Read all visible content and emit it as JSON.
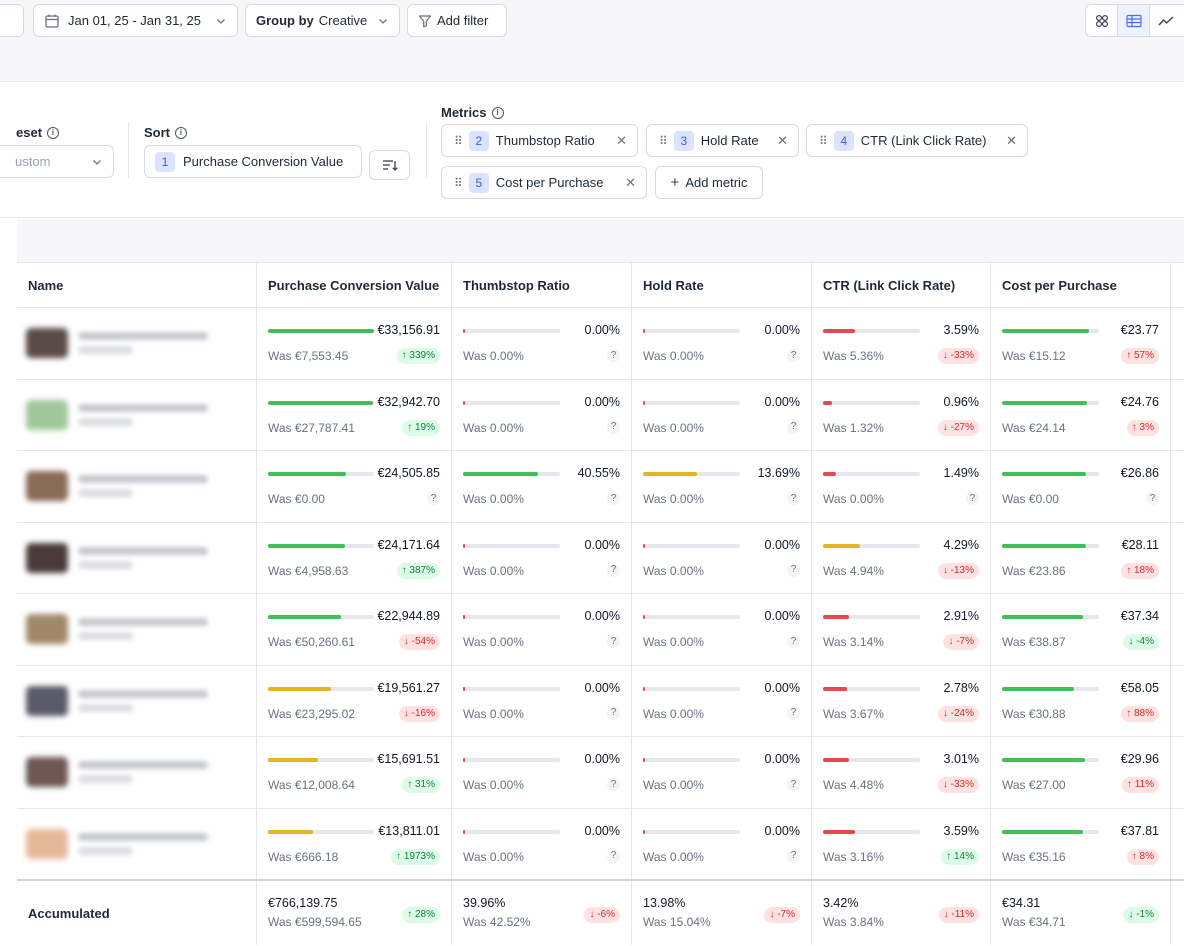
{
  "toolbar": {
    "date_range": "Jan 01, 25 - Jan 31, 25",
    "group_by_label": "Group by",
    "group_by_value": "Creative",
    "add_filter": "Add filter",
    "calendar_icon": "calendar-icon",
    "filter_icon": "filter-icon",
    "views": [
      {
        "icon": "grid-view-icon",
        "active": false
      },
      {
        "icon": "table-view-icon",
        "active": true
      },
      {
        "icon": "trend-view-icon",
        "active": false
      }
    ]
  },
  "config": {
    "preset_label": "eset",
    "preset_value": "ustom",
    "sort_label": "Sort",
    "sort_index": "1",
    "sort_metric": "Purchase Conversion Value",
    "metrics_label": "Metrics",
    "metrics": [
      {
        "index": "2",
        "label": "Thumbstop Ratio"
      },
      {
        "index": "3",
        "label": "Hold Rate"
      },
      {
        "index": "4",
        "label": "CTR (Link Click Rate)"
      },
      {
        "index": "5",
        "label": "Cost per Purchase"
      }
    ],
    "add_metric": "Add metric"
  },
  "table": {
    "columns": [
      "Name",
      "Purchase Conversion Value",
      "Thumbstop Ratio",
      "Hold Rate",
      "CTR (Link Click Rate)",
      "Cost per Purchase"
    ],
    "rows": [
      {
        "thumb_color": "#5a4a48",
        "cells": [
          {
            "value": "€33,156.91",
            "was": "Was €7,553.45",
            "change": "↑ 339%",
            "dir": "up",
            "bar": 1.0,
            "color": "#3fbf57"
          },
          {
            "value": "0.00%",
            "was": "Was 0.00%",
            "change": "?",
            "dir": "q",
            "bar": 0.0,
            "color": "#e5484d"
          },
          {
            "value": "0.00%",
            "was": "Was 0.00%",
            "change": "?",
            "dir": "q",
            "bar": 0.0,
            "color": "#e5484d"
          },
          {
            "value": "3.59%",
            "was": "Was 5.36%",
            "change": "↓ -33%",
            "dir": "down",
            "bar": 0.33,
            "color": "#e5484d"
          },
          {
            "value": "€23.77",
            "was": "Was €15.12",
            "change": "↑ 57%",
            "dir": "down",
            "bar": 0.9,
            "color": "#3fbf57"
          }
        ]
      },
      {
        "thumb_color": "#9fc79a",
        "cells": [
          {
            "value": "€32,942.70",
            "was": "Was €27,787.41",
            "change": "↑ 19%",
            "dir": "up",
            "bar": 0.99,
            "color": "#3fbf57"
          },
          {
            "value": "0.00%",
            "was": "Was 0.00%",
            "change": "?",
            "dir": "q",
            "bar": 0.0,
            "color": "#e5484d"
          },
          {
            "value": "0.00%",
            "was": "Was 0.00%",
            "change": "?",
            "dir": "q",
            "bar": 0.0,
            "color": "#e5484d"
          },
          {
            "value": "0.96%",
            "was": "Was 1.32%",
            "change": "↓ -27%",
            "dir": "down",
            "bar": 0.09,
            "color": "#e5484d"
          },
          {
            "value": "€24.76",
            "was": "Was €24.14",
            "change": "↑ 3%",
            "dir": "down",
            "bar": 0.88,
            "color": "#3fbf57"
          }
        ]
      },
      {
        "thumb_color": "#8a6a58",
        "cells": [
          {
            "value": "€24,505.85",
            "was": "Was €0.00",
            "change": "?",
            "dir": "q",
            "bar": 0.74,
            "color": "#3fbf57"
          },
          {
            "value": "40.55%",
            "was": "Was 0.00%",
            "change": "?",
            "dir": "q",
            "bar": 0.77,
            "color": "#3fbf57"
          },
          {
            "value": "13.69%",
            "was": "Was 0.00%",
            "change": "?",
            "dir": "q",
            "bar": 0.56,
            "color": "#e6b422"
          },
          {
            "value": "1.49%",
            "was": "Was 0.00%",
            "change": "?",
            "dir": "q",
            "bar": 0.13,
            "color": "#e5484d"
          },
          {
            "value": "€26.86",
            "was": "Was €0.00",
            "change": "?",
            "dir": "q",
            "bar": 0.87,
            "color": "#3fbf57"
          }
        ]
      },
      {
        "thumb_color": "#4a3a3a",
        "cells": [
          {
            "value": "€24,171.64",
            "was": "Was €4,958.63",
            "change": "↑ 387%",
            "dir": "up",
            "bar": 0.73,
            "color": "#3fbf57"
          },
          {
            "value": "0.00%",
            "was": "Was 0.00%",
            "change": "?",
            "dir": "q",
            "bar": 0.0,
            "color": "#e5484d"
          },
          {
            "value": "0.00%",
            "was": "Was 0.00%",
            "change": "?",
            "dir": "q",
            "bar": 0.0,
            "color": "#e5484d"
          },
          {
            "value": "4.29%",
            "was": "Was 4.94%",
            "change": "↓ -13%",
            "dir": "down",
            "bar": 0.38,
            "color": "#e6b422"
          },
          {
            "value": "€28.11",
            "was": "Was €23.86",
            "change": "↑ 18%",
            "dir": "down",
            "bar": 0.87,
            "color": "#3fbf57"
          }
        ]
      },
      {
        "thumb_color": "#a0886a",
        "cells": [
          {
            "value": "€22,944.89",
            "was": "Was €50,260.61",
            "change": "↓ -54%",
            "dir": "down",
            "bar": 0.69,
            "color": "#3fbf57"
          },
          {
            "value": "0.00%",
            "was": "Was 0.00%",
            "change": "?",
            "dir": "q",
            "bar": 0.0,
            "color": "#e5484d"
          },
          {
            "value": "0.00%",
            "was": "Was 0.00%",
            "change": "?",
            "dir": "q",
            "bar": 0.0,
            "color": "#e5484d"
          },
          {
            "value": "2.91%",
            "was": "Was 3.14%",
            "change": "↓ -7%",
            "dir": "down",
            "bar": 0.27,
            "color": "#e5484d"
          },
          {
            "value": "€37.34",
            "was": "Was €38.87",
            "change": "↓ -4%",
            "dir": "up",
            "bar": 0.83,
            "color": "#3fbf57"
          }
        ]
      },
      {
        "thumb_color": "#5a5a6a",
        "cells": [
          {
            "value": "€19,561.27",
            "was": "Was €23,295.02",
            "change": "↓ -16%",
            "dir": "down",
            "bar": 0.59,
            "color": "#e6b422"
          },
          {
            "value": "0.00%",
            "was": "Was 0.00%",
            "change": "?",
            "dir": "q",
            "bar": 0.0,
            "color": "#e5484d"
          },
          {
            "value": "0.00%",
            "was": "Was 0.00%",
            "change": "?",
            "dir": "q",
            "bar": 0.0,
            "color": "#e5484d"
          },
          {
            "value": "2.78%",
            "was": "Was 3.67%",
            "change": "↓ -24%",
            "dir": "down",
            "bar": 0.25,
            "color": "#e5484d"
          },
          {
            "value": "€58.05",
            "was": "Was €30.88",
            "change": "↑ 88%",
            "dir": "down",
            "bar": 0.74,
            "color": "#3fbf57"
          }
        ]
      },
      {
        "thumb_color": "#6e5856",
        "cells": [
          {
            "value": "€15,691.51",
            "was": "Was €12,008.64",
            "change": "↑ 31%",
            "dir": "up",
            "bar": 0.47,
            "color": "#e6b422"
          },
          {
            "value": "0.00%",
            "was": "Was 0.00%",
            "change": "?",
            "dir": "q",
            "bar": 0.0,
            "color": "#e5484d"
          },
          {
            "value": "0.00%",
            "was": "Was 0.00%",
            "change": "?",
            "dir": "q",
            "bar": 0.0,
            "color": "#e5484d"
          },
          {
            "value": "3.01%",
            "was": "Was 4.48%",
            "change": "↓ -33%",
            "dir": "down",
            "bar": 0.27,
            "color": "#e5484d"
          },
          {
            "value": "€29.96",
            "was": "Was €27.00",
            "change": "↑ 11%",
            "dir": "down",
            "bar": 0.86,
            "color": "#3fbf57"
          }
        ]
      },
      {
        "thumb_color": "#e6b89a",
        "cells": [
          {
            "value": "€13,811.01",
            "was": "Was €666.18",
            "change": "↑ 1973%",
            "dir": "up",
            "bar": 0.42,
            "color": "#e6b422"
          },
          {
            "value": "0.00%",
            "was": "Was 0.00%",
            "change": "?",
            "dir": "q",
            "bar": 0.0,
            "color": "#e5484d"
          },
          {
            "value": "0.00%",
            "was": "Was 0.00%",
            "change": "?",
            "dir": "q",
            "bar": 0.0,
            "color": "#e5484d"
          },
          {
            "value": "3.59%",
            "was": "Was 3.16%",
            "change": "↑ 14%",
            "dir": "up",
            "bar": 0.33,
            "color": "#e5484d"
          },
          {
            "value": "€37.81",
            "was": "Was €35.16",
            "change": "↑ 8%",
            "dir": "down",
            "bar": 0.83,
            "color": "#3fbf57"
          }
        ]
      }
    ],
    "accumulated": {
      "label": "Accumulated",
      "cells": [
        {
          "value": "€766,139.75",
          "was": "Was €599,594.65",
          "change": "↑ 28%",
          "dir": "up"
        },
        {
          "value": "39.96%",
          "was": "Was 42.52%",
          "change": "↓ -6%",
          "dir": "down"
        },
        {
          "value": "13.98%",
          "was": "Was 15.04%",
          "change": "↓ -7%",
          "dir": "down"
        },
        {
          "value": "3.42%",
          "was": "Was 3.84%",
          "change": "↓ -11%",
          "dir": "down"
        },
        {
          "value": "€34.31",
          "was": "Was €34.71",
          "change": "↓ -1%",
          "dir": "up"
        }
      ]
    }
  }
}
